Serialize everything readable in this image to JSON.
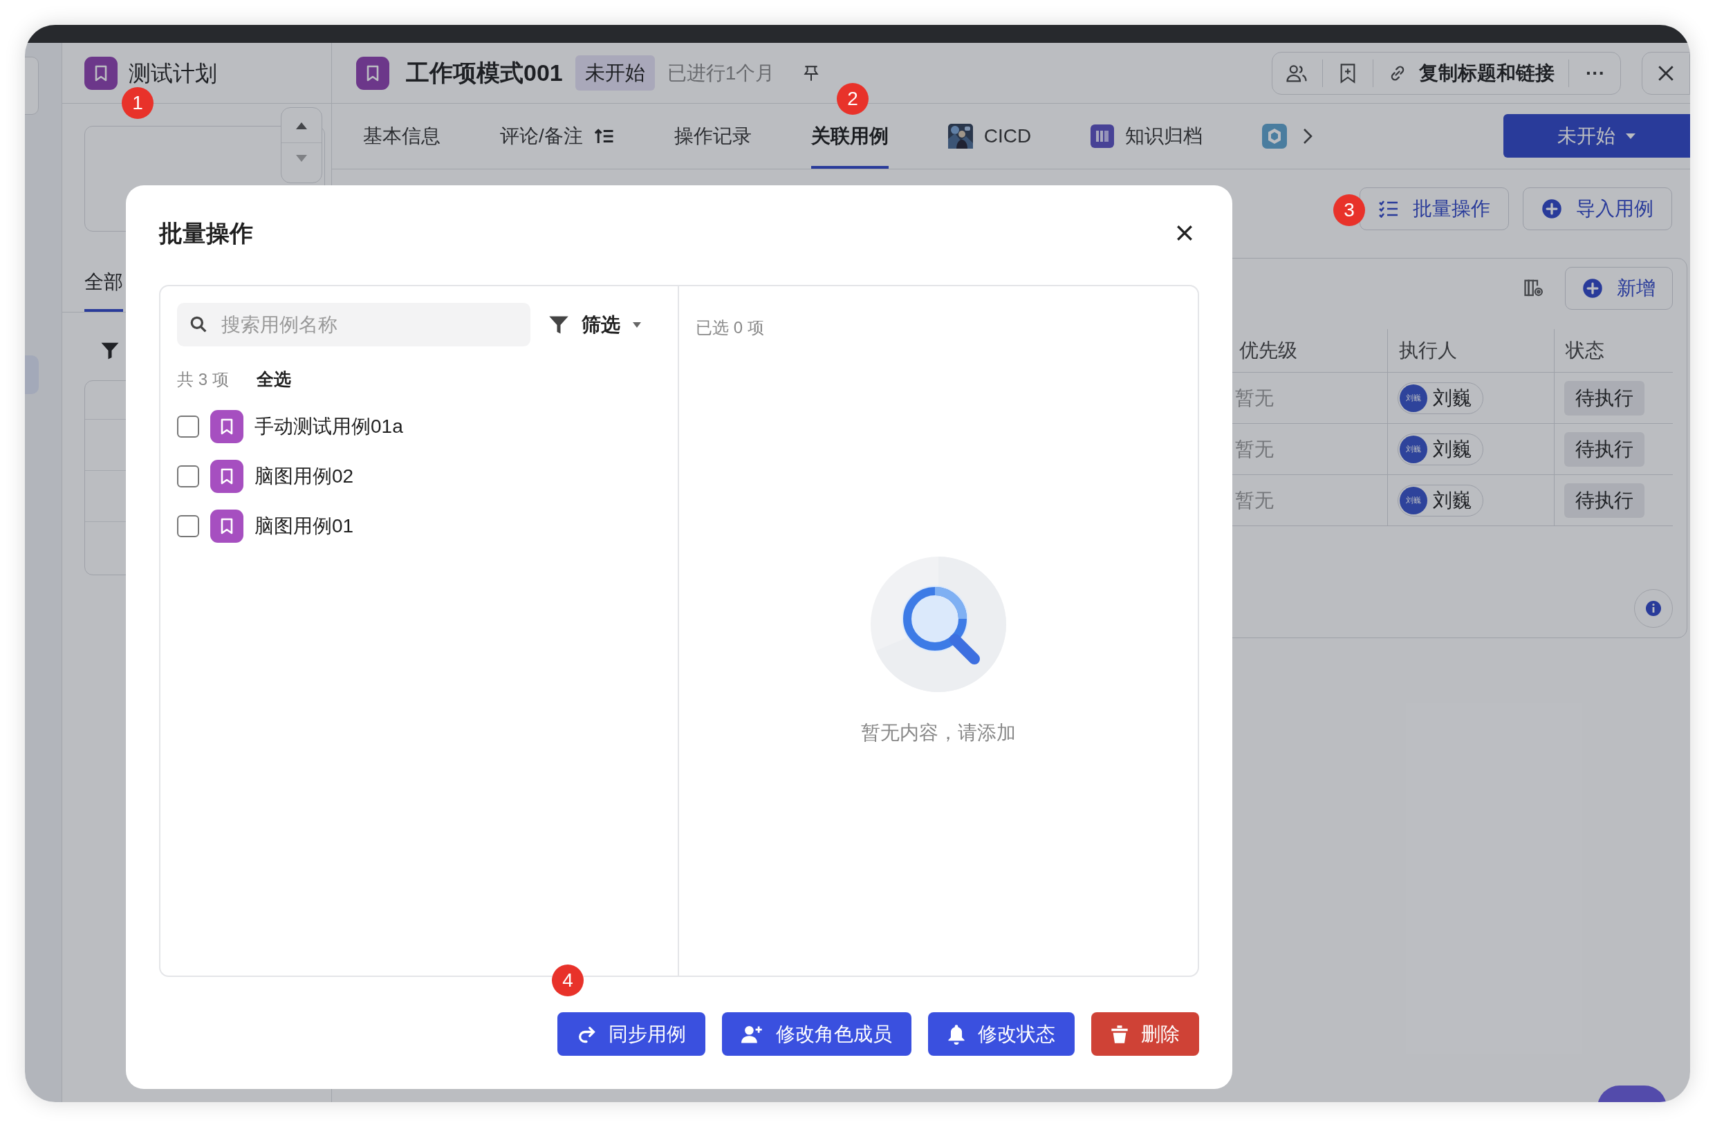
{
  "sidebar": {
    "title": "测试计划",
    "tabs": [
      {
        "label": "全部",
        "selected": true
      }
    ]
  },
  "header": {
    "title": "工作项模式001",
    "status_badge": "未开始",
    "elapsed": "已进行1个月",
    "copy_link": "复制标题和链接",
    "more": "···"
  },
  "tabs": [
    {
      "kind": "text",
      "label": "基本信息",
      "selected": false
    },
    {
      "kind": "sort",
      "label": "评论/备注",
      "selected": false
    },
    {
      "kind": "text",
      "label": "操作记录",
      "selected": false
    },
    {
      "kind": "text",
      "label": "关联用例",
      "selected": true
    },
    {
      "kind": "avatar",
      "label": "CICD",
      "selected": false
    },
    {
      "kind": "book",
      "label": "知识归档",
      "selected": false
    },
    {
      "kind": "app",
      "selected": false
    }
  ],
  "status_button": "未开始",
  "actions": [
    {
      "kind": "list",
      "label": "批量操作"
    },
    {
      "kind": "plus",
      "label": "导入用例"
    }
  ],
  "case_table": {
    "add_button": "新增",
    "columns": [
      "优先级",
      "执行人",
      "状态"
    ],
    "rows": [
      {
        "priority": "暂无",
        "avatar": "刘巍",
        "executor": "刘巍",
        "status": "待执行"
      },
      {
        "priority": "暂无",
        "avatar": "刘巍",
        "executor": "刘巍",
        "status": "待执行"
      },
      {
        "priority": "暂无",
        "avatar": "刘巍",
        "executor": "刘巍",
        "status": "待执行"
      }
    ]
  },
  "markers": [
    "1",
    "2",
    "3",
    "4"
  ],
  "dialog": {
    "title": "批量操作",
    "search": {
      "placeholder": "搜索用例名称"
    },
    "filter": "筛选",
    "count": "共 3 项",
    "select_all": "全选",
    "selected_count": "已选 0 项",
    "items": [
      {
        "label": "手动测试用例01a",
        "checked": false
      },
      {
        "label": "脑图用例02",
        "checked": false
      },
      {
        "label": "脑图用例01",
        "checked": false
      }
    ],
    "empty_text": "暂无内容，请添加",
    "buttons": [
      {
        "kind": "sync",
        "label": "同步用例"
      },
      {
        "kind": "member",
        "label": "修改角色成员"
      },
      {
        "kind": "bell",
        "label": "修改状态"
      },
      {
        "kind": "delete",
        "label": "删除"
      }
    ]
  }
}
